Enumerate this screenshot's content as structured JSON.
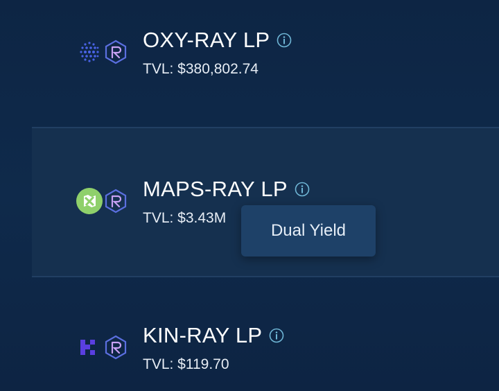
{
  "pools": [
    {
      "name": "OXY-RAY LP",
      "tvl": "TVL: $380,802.74",
      "token_icon": "oxy-token-icon"
    },
    {
      "name": "MAPS-RAY LP",
      "tvl": "TVL: $3.43M",
      "token_icon": "maps-token-icon"
    },
    {
      "name": "KIN-RAY LP",
      "tvl": "TVL: $119.70",
      "token_icon": "kin-token-icon"
    }
  ],
  "tooltip": {
    "text": "Dual Yield"
  },
  "colors": {
    "background": "#0e2747",
    "highlight_row": "#15304f",
    "tooltip_bg": "#1e4168",
    "info_icon": "#6fb6d6",
    "ray_icon": "#5b6fe0"
  }
}
